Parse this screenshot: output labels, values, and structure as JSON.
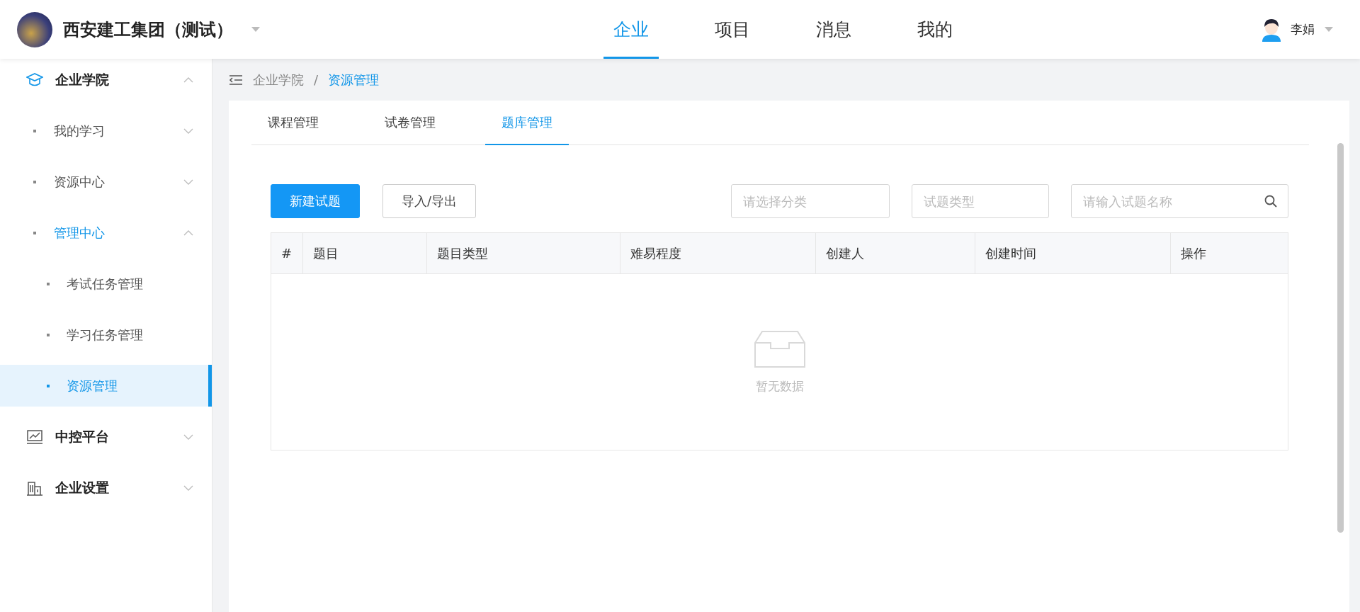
{
  "header": {
    "company": "西安建工集团（测试）",
    "nav": [
      {
        "label": "企业",
        "selected": true
      },
      {
        "label": "项目",
        "selected": false
      },
      {
        "label": "消息",
        "selected": false
      },
      {
        "label": "我的",
        "selected": false
      }
    ],
    "user": "李娟"
  },
  "sidebar": {
    "items": [
      {
        "label": "企业学院",
        "expanded": true,
        "children": [
          {
            "label": "我的学习",
            "expanded": false,
            "highlighted": false,
            "selected": false
          },
          {
            "label": "资源中心",
            "expanded": false,
            "highlighted": false,
            "selected": false
          },
          {
            "label": "管理中心",
            "expanded": true,
            "highlighted": true,
            "selected": false,
            "children": [
              {
                "label": "考试任务管理",
                "selected": false
              },
              {
                "label": "学习任务管理",
                "selected": false
              },
              {
                "label": "资源管理",
                "selected": true
              }
            ]
          }
        ]
      },
      {
        "label": "中控平台",
        "expanded": false
      },
      {
        "label": "企业设置",
        "expanded": false
      }
    ]
  },
  "breadcrumb": [
    {
      "label": "企业学院",
      "current": false
    },
    {
      "label": "资源管理",
      "current": true
    }
  ],
  "breadcrumb_separator": "/",
  "tabs": [
    {
      "label": "课程管理",
      "selected": false
    },
    {
      "label": "试卷管理",
      "selected": false
    },
    {
      "label": "题库管理",
      "selected": true
    }
  ],
  "buttons": [
    {
      "label": "新建试题",
      "kind": "primary"
    },
    {
      "label": "导入/导出",
      "kind": "default"
    }
  ],
  "filters": [
    {
      "placeholder": "请选择分类",
      "kind": "select"
    },
    {
      "placeholder": "试题类型",
      "kind": "select"
    },
    {
      "placeholder": "请输入试题名称",
      "kind": "search"
    }
  ],
  "table": {
    "columns": [
      "#",
      "题目",
      "题目类型",
      "难易程度",
      "创建人",
      "创建时间",
      "操作"
    ],
    "empty_text": "暂无数据"
  }
}
